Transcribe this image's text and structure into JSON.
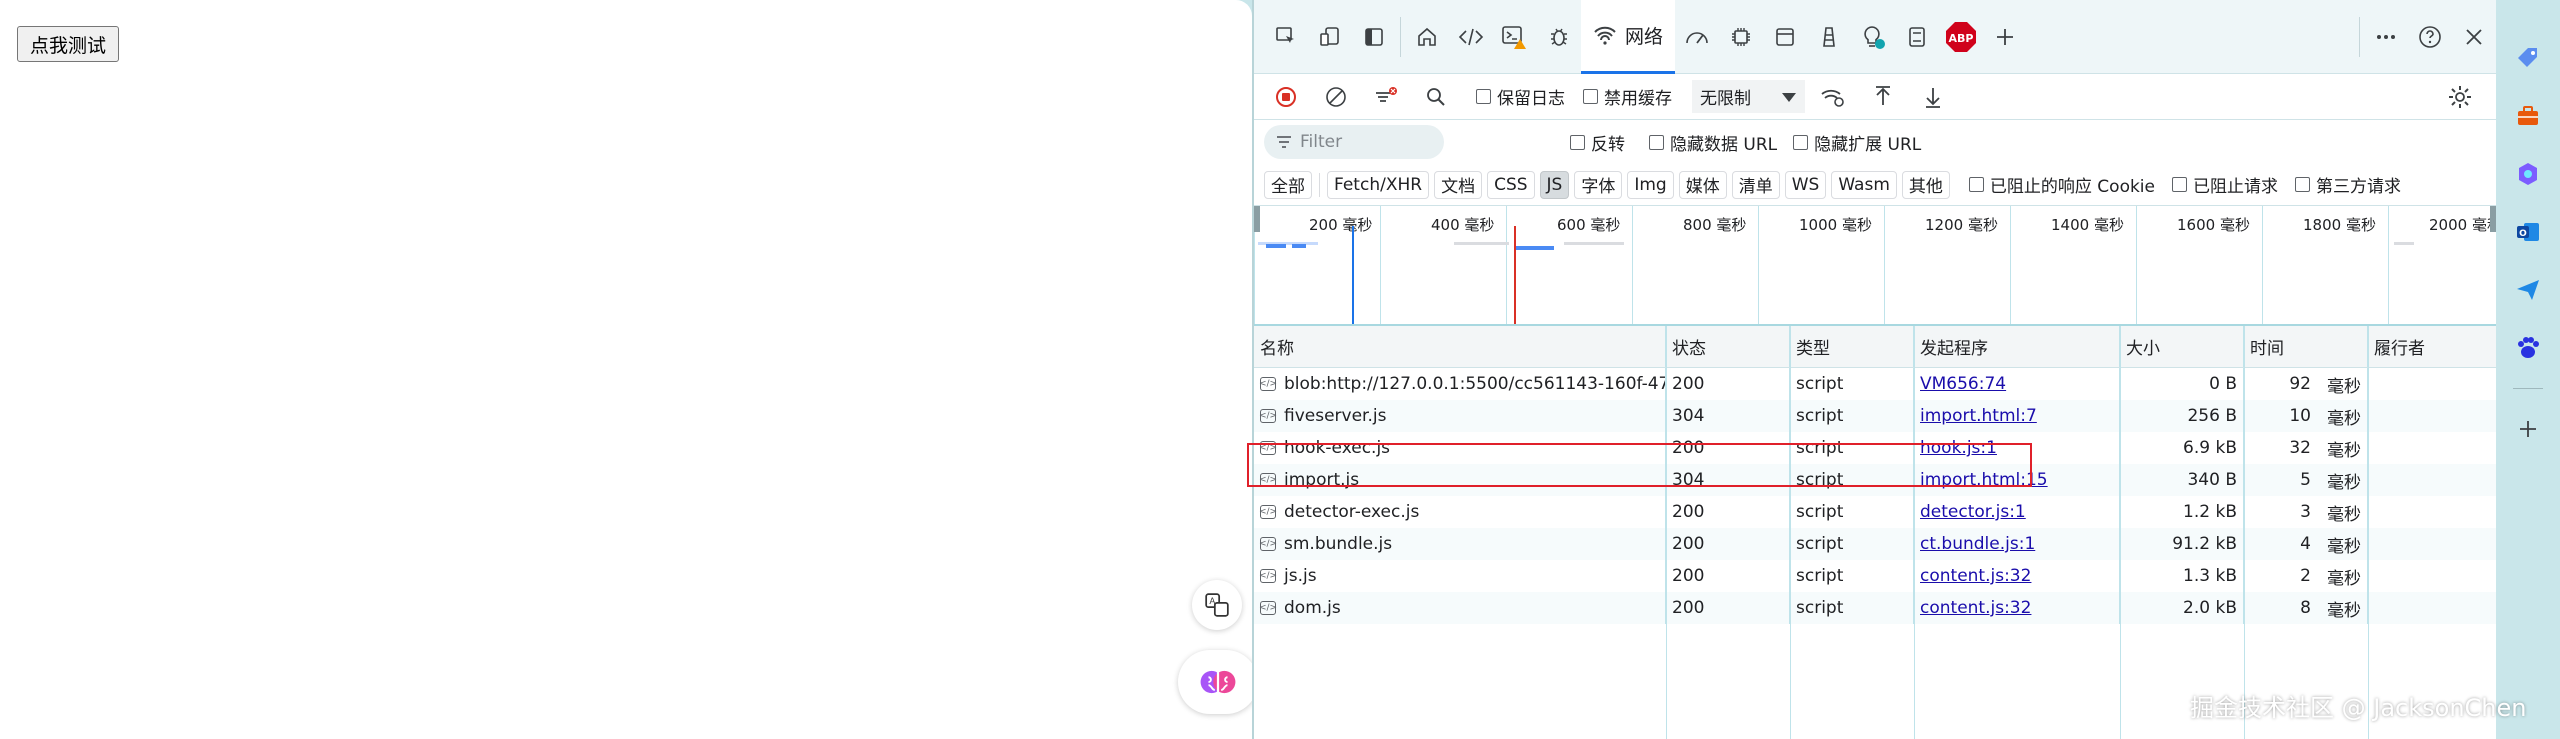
{
  "page": {
    "button_label": "点我测试"
  },
  "devtools": {
    "network_tab_label": "网络",
    "toolbar": {
      "preserve_log": "保留日志",
      "disable_cache": "禁用缓存",
      "throttling": "无限制"
    },
    "filter": {
      "placeholder": "Filter",
      "invert": "反转",
      "hide_data_urls": "隐藏数据 URL",
      "hide_extension_urls": "隐藏扩展 URL"
    },
    "type_filters": [
      "全部",
      "Fetch/XHR",
      "文档",
      "CSS",
      "JS",
      "字体",
      "Img",
      "媒体",
      "清单",
      "WS",
      "Wasm",
      "其他"
    ],
    "active_type": "JS",
    "extra_filters": {
      "blocked_cookies": "已阻止的响应 Cookie",
      "blocked_requests": "已阻止请求",
      "third_party": "第三方请求"
    },
    "overview_ticks": [
      "200 毫秒",
      "400 毫秒",
      "600 毫秒",
      "800 毫秒",
      "1000 毫秒",
      "1200 毫秒",
      "1400 毫秒",
      "1600 毫秒",
      "1800 毫秒",
      "2000 毫秒"
    ],
    "columns": {
      "name": "名称",
      "status": "状态",
      "type": "类型",
      "initiator": "发起程序",
      "size": "大小",
      "time": "时间",
      "fulfilled_by": "履行者"
    },
    "requests": [
      {
        "name": "blob:http://127.0.0.1:5500/cc561143-160f-47f...",
        "status": "200",
        "type": "script",
        "initiator": "VM656:74",
        "size": "0 B",
        "time": "92",
        "unit": "毫秒"
      },
      {
        "name": "fiveserver.js",
        "status": "304",
        "type": "script",
        "initiator": "import.html:7",
        "size": "256 B",
        "time": "10",
        "unit": "毫秒"
      },
      {
        "name": "hook-exec.js",
        "status": "200",
        "type": "script",
        "initiator": "hook.js:1",
        "size": "6.9 kB",
        "time": "32",
        "unit": "毫秒"
      },
      {
        "name": "import.js",
        "status": "304",
        "type": "script",
        "initiator": "import.html:15",
        "size": "340 B",
        "time": "5",
        "unit": "毫秒"
      },
      {
        "name": "detector-exec.js",
        "status": "200",
        "type": "script",
        "initiator": "detector.js:1",
        "size": "1.2 kB",
        "time": "3",
        "unit": "毫秒"
      },
      {
        "name": "sm.bundle.js",
        "status": "200",
        "type": "script",
        "initiator": "ct.bundle.js:1",
        "size": "91.2 kB",
        "time": "4",
        "unit": "毫秒"
      },
      {
        "name": "js.js",
        "status": "200",
        "type": "script",
        "initiator": "content.js:32",
        "size": "1.3 kB",
        "time": "2",
        "unit": "毫秒"
      },
      {
        "name": "dom.js",
        "status": "200",
        "type": "script",
        "initiator": "content.js:32",
        "size": "2.0 kB",
        "time": "8",
        "unit": "毫秒"
      }
    ]
  },
  "watermark": "掘金技术社区 @ JacksonChen",
  "colors": {
    "accent": "#1a73e8",
    "highlight": "#e0202a",
    "abp": "#d0021b",
    "record_stop": "#d93025"
  }
}
